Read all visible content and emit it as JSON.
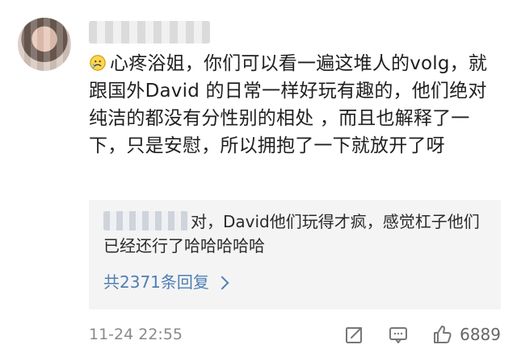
{
  "comment": {
    "text": "心疼浴姐，你们可以看一遍这堆人的volg，就跟国外David 的日常一样好玩有趣的，他们绝对纯洁的都没有分性别的相处 ，而且也解释了一下，只是安慰，所以拥抱了一下就放开了呀"
  },
  "reply": {
    "text": "对，David他们玩得才疯，感觉杠子他们已经还行了哈哈哈哈哈",
    "more_label": "共2371条回复"
  },
  "footer": {
    "timestamp": "11-24 22:55",
    "like_count": "6889"
  },
  "colors": {
    "link": "#4f7fb3",
    "reply_bg": "#f4f4f4"
  },
  "icons": {
    "emoji": "sad-emoji-icon",
    "repost": "repost-icon",
    "comment": "comment-icon",
    "like": "thumbs-up-icon",
    "chevron": "chevron-right-icon"
  }
}
